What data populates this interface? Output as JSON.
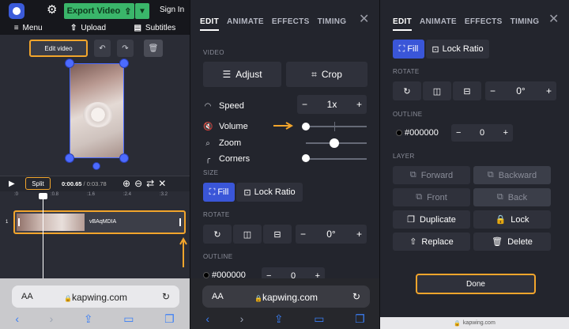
{
  "panel1": {
    "export_label": "Export Video",
    "signin": "Sign In",
    "nav": [
      "Menu",
      "Upload",
      "Subtitles"
    ],
    "edit_video": "Edit video",
    "split": "Split",
    "time_current": "0:00.65",
    "time_total": "/ 0:03.78",
    "ruler": [
      ":0",
      ":0.8",
      ":1.6",
      ":2.4",
      ":3.2"
    ],
    "track_name": "vBAqMDIA",
    "track_num": "1"
  },
  "panel2": {
    "tabs": [
      "EDIT",
      "ANIMATE",
      "EFFECTS",
      "TIMING"
    ],
    "video_heading": "VIDEO",
    "adjust": "Adjust",
    "crop": "Crop",
    "speed_label": "Speed",
    "speed_value": "1x",
    "volume_label": "Volume",
    "zoom_label": "Zoom",
    "corners_label": "Corners",
    "size_heading": "SIZE",
    "fill": "Fill",
    "lock_ratio": "Lock Ratio",
    "rotate_heading": "ROTATE",
    "rotation": "0°",
    "outline_heading": "OUTLINE",
    "outline_color": "#000000",
    "outline_width": "0"
  },
  "panel3": {
    "tabs": [
      "EDIT",
      "ANIMATE",
      "EFFECTS",
      "TIMING"
    ],
    "fill": "Fill",
    "lock_ratio": "Lock Ratio",
    "rotate_heading": "ROTATE",
    "rotation": "0°",
    "outline_heading": "OUTLINE",
    "outline_color": "#000000",
    "outline_width": "0",
    "layer_heading": "LAYER",
    "forward": "Forward",
    "backward": "Backward",
    "front": "Front",
    "back": "Back",
    "duplicate": "Duplicate",
    "lock": "Lock",
    "replace": "Replace",
    "delete": "Delete",
    "done": "Done",
    "bottom_url": "kapwing.com"
  },
  "safari": {
    "aa": "AA",
    "url": "kapwing.com"
  },
  "colors": {
    "accent_blue": "#3a56d8",
    "highlight_orange": "#f2a52c",
    "export_green": "#3ab66a"
  }
}
